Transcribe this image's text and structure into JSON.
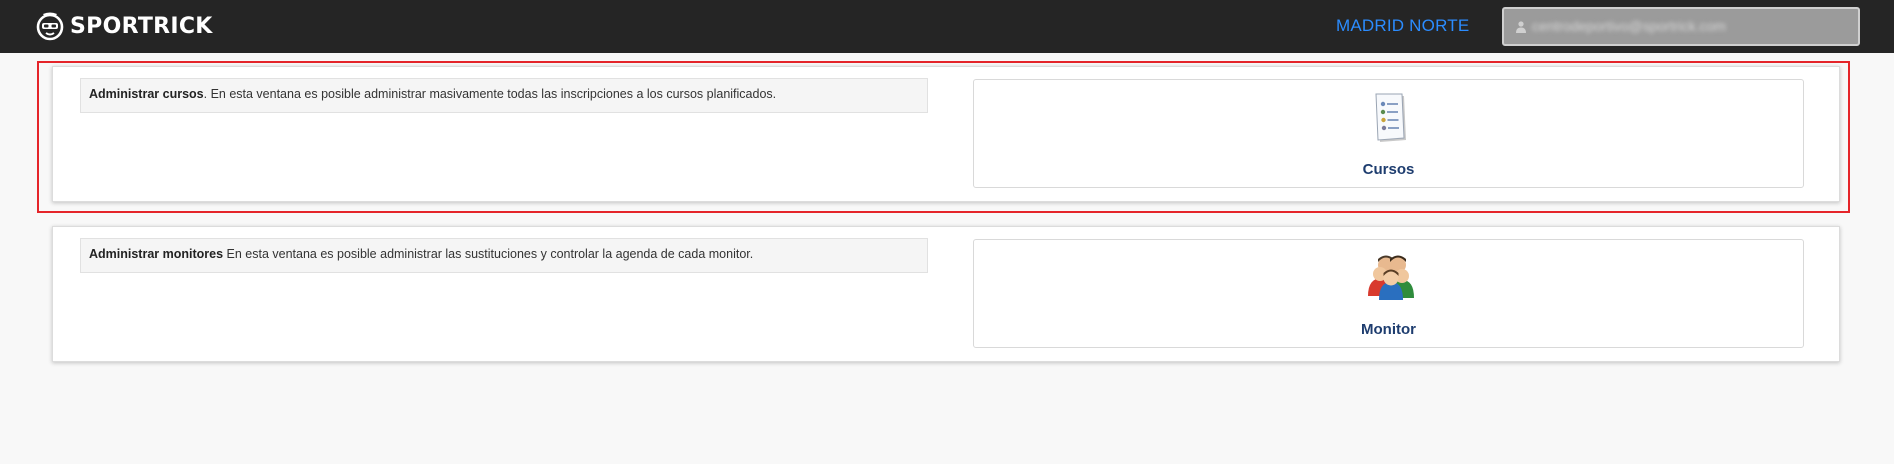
{
  "header": {
    "brand": "SPORTRICK",
    "brand_icon": "sportrick-logo-icon",
    "location": "MADRID NORTE",
    "user_email": "centrodeportivo@sportrick.com",
    "user_icon": "user-icon",
    "colors": {
      "bar": "#252525",
      "location": "#2b8cff"
    }
  },
  "modules": [
    {
      "title": "Administrar cursos",
      "description": ". En esta ventana es posible administrar masivamente todas las inscripciones a los cursos planificados.",
      "button_label": "Cursos",
      "icon": "course-list-icon",
      "highlighted": true
    },
    {
      "title": "Administrar monitores",
      "description": " En esta ventana es posible administrar las sustituciones y controlar la agenda de cada monitor.",
      "button_label": "Monitor",
      "icon": "monitors-group-icon",
      "highlighted": false
    }
  ],
  "colors": {
    "highlight_border": "#e5252a",
    "label": "#1e3d6f"
  }
}
